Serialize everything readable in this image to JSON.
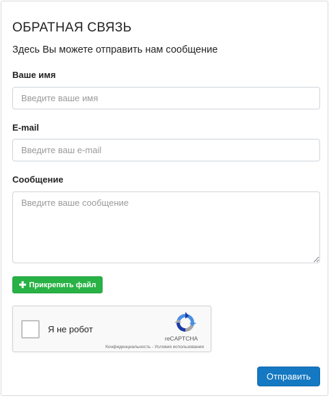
{
  "form": {
    "title": "ОБРАТНАЯ СВЯЗЬ",
    "subtitle": "Здесь Вы можете отправить нам сообщение",
    "name_label": "Ваше имя",
    "name_placeholder": "Введите ваше имя",
    "email_label": "E-mail",
    "email_placeholder": "Введите ваш e-mail",
    "message_label": "Сообщение",
    "message_placeholder": "Введите ваше сообщение",
    "attach_label": "Прикрепить файл",
    "submit_label": "Отправить"
  },
  "captcha": {
    "label": "Я не робот",
    "brand": "reCAPTCHA",
    "privacy": "Конфиденциальность",
    "separator": " - ",
    "terms": "Условия использования"
  },
  "colors": {
    "attach_button": "#28b245",
    "submit_button": "#1478c2"
  },
  "icons": {
    "attach": "plus-icon",
    "captcha": "recaptcha-logo-icon"
  }
}
